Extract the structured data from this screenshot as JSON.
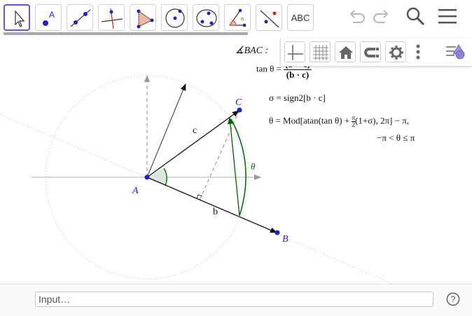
{
  "toolbar": {
    "tools": [
      {
        "name": "move-tool-icon"
      },
      {
        "name": "point-tool-icon"
      },
      {
        "name": "line-tool-icon"
      },
      {
        "name": "perpendicular-line-tool-icon"
      },
      {
        "name": "polygon-tool-icon"
      },
      {
        "name": "circle-tool-icon"
      },
      {
        "name": "conic-tool-icon"
      },
      {
        "name": "angle-tool-icon"
      },
      {
        "name": "reflect-tool-icon"
      },
      {
        "name": "text-tool-icon",
        "label": "ABC"
      }
    ],
    "right_icons": [
      "undo-icon",
      "redo-icon",
      "search-icon",
      "menu-icon"
    ],
    "accent_color": "#6557d2"
  },
  "style_bar": {
    "buttons": [
      "axes-toggle-icon",
      "grid-toggle-icon",
      "home-icon",
      "magnet-snap-icon",
      "settings-icon",
      "more-icon",
      "style-bar-toggle-icon"
    ]
  },
  "graphics": {
    "points": [
      {
        "label": "A",
        "color": "#1f1fcc"
      },
      {
        "label": "B",
        "color": "#1f1fcc"
      },
      {
        "label": "C",
        "color": "#1f1fcc"
      }
    ],
    "segment_labels": {
      "c": "c",
      "b": "b"
    },
    "angle_label": "θ",
    "angle_color": "#006400",
    "formulas": {
      "angle_name": "∡BAC :",
      "tan_lhs": "tan θ = ",
      "tan_num": "(b × c)",
      "tan_den": "(b · c)",
      "sigma_line": "σ = sign2[b · c]",
      "theta_lhs": "θ = Mod[atan(tan θ) + ",
      "theta_frac_num": "π",
      "theta_frac_den": "2",
      "theta_rhs": "(1+σ), 2π] − π,",
      "range": "−π < θ ≤ π"
    }
  },
  "input_bar": {
    "placeholder": "Input…",
    "help_label": "?"
  }
}
